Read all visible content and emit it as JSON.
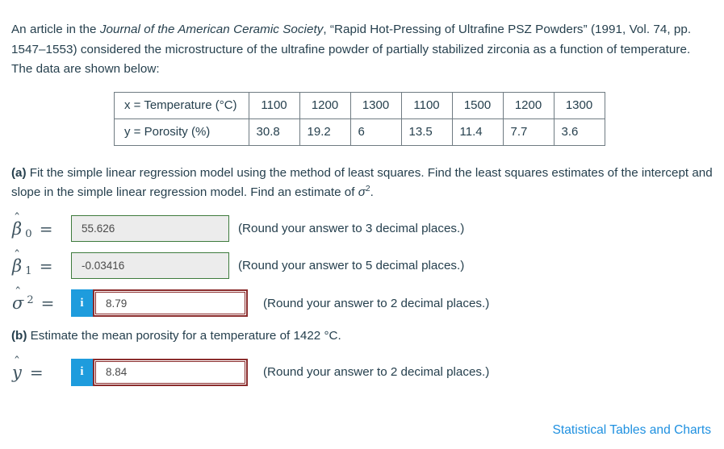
{
  "intro": {
    "part1": "An article in the ",
    "journal": "Journal of the American Ceramic Society",
    "part2": ", “Rapid Hot-Pressing of Ultrafine PSZ Powders” (1991, Vol. 74, pp. 1547–1553) considered the microstructure of the ultrafine powder of partially stabilized zirconia as a function of temperature. The data are shown below:"
  },
  "table": {
    "rows": [
      {
        "label": "x = Temperature (°C)",
        "values": [
          "1100",
          "1200",
          "1300",
          "1100",
          "1500",
          "1200",
          "1300"
        ]
      },
      {
        "label": "y = Porosity (%)",
        "values": [
          "30.8",
          "19.2",
          "6",
          "13.5",
          "11.4",
          "7.7",
          "3.6"
        ]
      }
    ]
  },
  "part_a": {
    "label": "(a)",
    "text_before": " Fit the simple linear regression model using the method of least squares. Find the least squares estimates of the intercept and slope in the simple linear regression model. Find an estimate of ",
    "sigma": "σ",
    "exponent": "2",
    "text_after": "."
  },
  "answers_a": [
    {
      "symbol_char": "β",
      "hat": "ˆ",
      "subscript": "0",
      "equals": "=",
      "value": "55.626",
      "hint": "(Round your answer to 3 decimal places.)",
      "state": "green"
    },
    {
      "symbol_char": "β",
      "hat": "ˆ",
      "subscript": "1",
      "equals": "=",
      "value": "-0.03416",
      "hint": "(Round your answer to 5 decimal places.)",
      "state": "green"
    },
    {
      "symbol_char": "σ",
      "hat": "ˆ",
      "superscript": "2",
      "equals": "=",
      "value": "8.79",
      "hint": "(Round your answer to 2 decimal places.)",
      "state": "red",
      "info_label": "i"
    }
  ],
  "part_b": {
    "label": "(b)",
    "text": " Estimate the mean porosity for a temperature of 1422 °C."
  },
  "answer_b": {
    "symbol_char": "y",
    "hat": "ˆ",
    "equals": "=",
    "value": "8.84",
    "hint": "(Round your answer to 2 decimal places.)",
    "state": "red",
    "info_label": "i"
  },
  "footer": {
    "link_text": "Statistical Tables and Charts"
  },
  "colors": {
    "text": "#26404e",
    "link": "#1e90e0",
    "info_blue": "#1e9cdd",
    "border_green": "#3e7b3d",
    "border_red": "#8b2d2d",
    "input_grey": "#ececec"
  }
}
